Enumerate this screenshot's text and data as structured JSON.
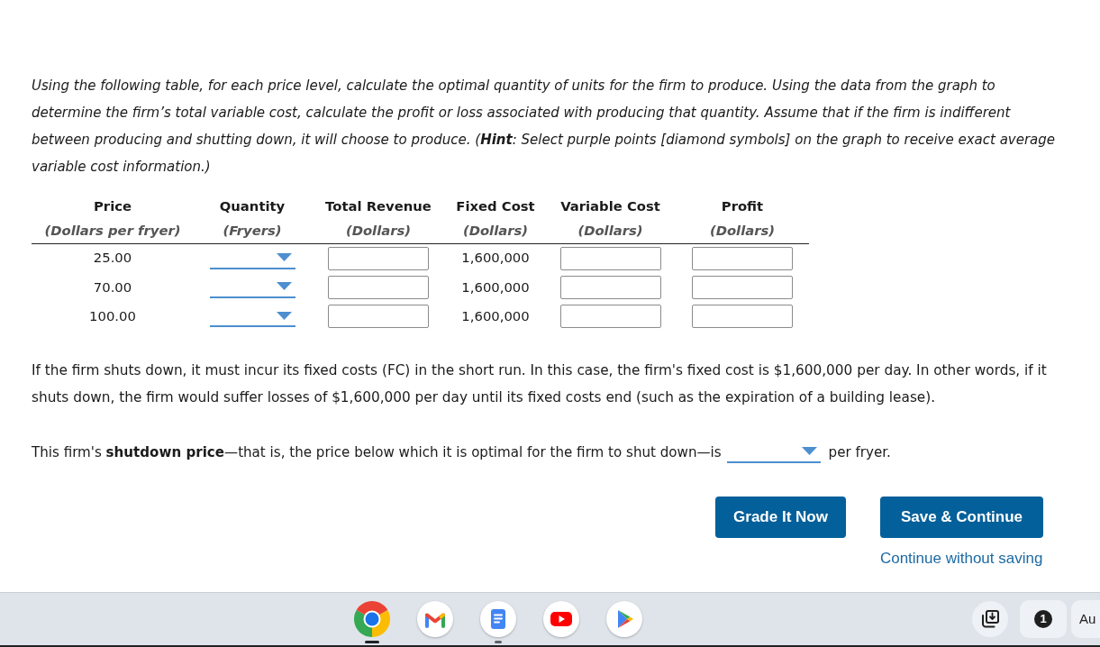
{
  "instructions": "Using the following table, for each price level, calculate the optimal quantity of units for the firm to produce. Using the data from the graph to determine the firm’s total variable cost, calculate the profit or loss associated with producing that quantity. Assume that if the firm is indifferent between producing and shutting down, it will choose to produce. (**Hint**: Select purple points [diamond symbols] on the graph to receive exact average variable cost information.)",
  "table": {
    "columns": [
      {
        "title": "Price",
        "unit": "(Dollars per fryer)",
        "kind": "text"
      },
      {
        "title": "Quantity",
        "unit": "(Fryers)",
        "kind": "select"
      },
      {
        "title": "Total Revenue",
        "unit": "(Dollars)",
        "kind": "input"
      },
      {
        "title": "Fixed Cost",
        "unit": "(Dollars)",
        "kind": "text"
      },
      {
        "title": "Variable Cost",
        "unit": "(Dollars)",
        "kind": "input"
      },
      {
        "title": "Profit",
        "unit": "(Dollars)",
        "kind": "input"
      }
    ],
    "rows": [
      {
        "cells": [
          "25.00",
          null,
          null,
          "1,600,000",
          null,
          null
        ]
      },
      {
        "cells": [
          "70.00",
          null,
          null,
          "1,600,000",
          null,
          null
        ]
      },
      {
        "cells": [
          "100.00",
          null,
          null,
          "1,600,000",
          null,
          null
        ]
      }
    ]
  },
  "note": "If the firm shuts down, it must incur its fixed costs (FC) in the short run. In this case, the firm's fixed cost is $1,600,000 per day. In other words, if it shuts down, the firm would suffer losses of $1,600,000 per day until its fixed costs end (such as the expiration of a building lease).",
  "question": {
    "text_before": "This firm's **shutdown price**—that is, the price below which it is optimal for the firm to shut down—is",
    "text_after": "per fryer."
  },
  "buttons": [
    {
      "label": "Grade It Now"
    },
    {
      "label": "Save & Continue"
    }
  ],
  "link": "Continue without saving",
  "shelf": {
    "apps": [
      {
        "kind": "chrome",
        "running": true,
        "active": true
      },
      {
        "kind": "gmail",
        "running": false,
        "active": false
      },
      {
        "kind": "docs",
        "running": true,
        "active": false
      },
      {
        "kind": "youtube",
        "running": false,
        "active": false
      },
      {
        "kind": "play",
        "running": false,
        "active": false
      }
    ],
    "notification_count": "1",
    "clock": "Au"
  }
}
